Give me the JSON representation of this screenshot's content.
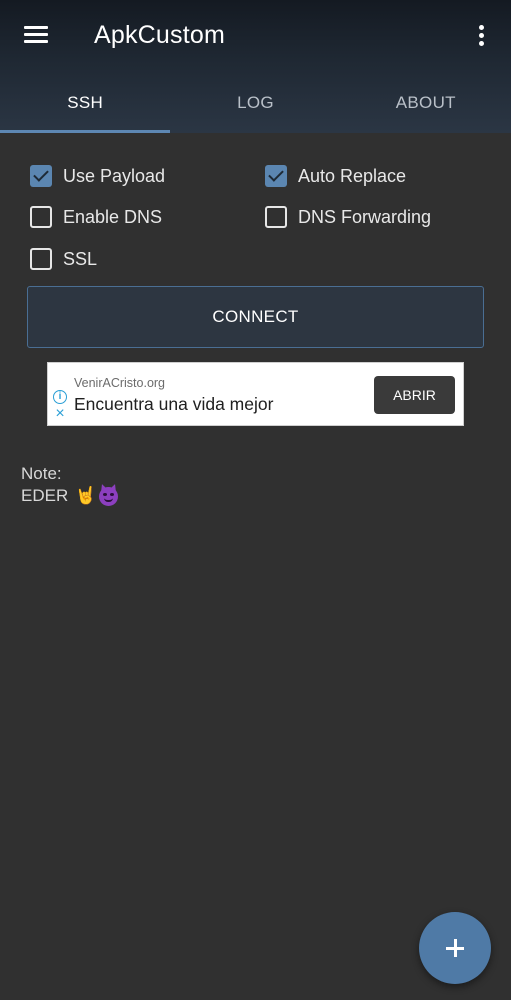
{
  "app": {
    "title": "ApkCustom"
  },
  "tabs": [
    {
      "label": "SSH",
      "active": true
    },
    {
      "label": "LOG",
      "active": false
    },
    {
      "label": "ABOUT",
      "active": false
    }
  ],
  "options": {
    "use_payload": {
      "label": "Use Payload",
      "checked": true
    },
    "auto_replace": {
      "label": "Auto Replace",
      "checked": true
    },
    "enable_dns": {
      "label": "Enable DNS",
      "checked": false
    },
    "dns_forwarding": {
      "label": "DNS Forwarding",
      "checked": false
    },
    "ssl": {
      "label": "SSL",
      "checked": false
    }
  },
  "connect": {
    "label": "CONNECT"
  },
  "ad": {
    "url": "VenirACristo.org",
    "headline": "Encuentra una vida mejor",
    "button": "ABRIR"
  },
  "note": {
    "label": "Note:",
    "text": "EDER",
    "emojis": [
      "sign-of-horns-emoji",
      "smiling-imp-emoji"
    ]
  },
  "icons": {
    "menu": "hamburger-menu-icon",
    "overflow": "more-vert-icon",
    "fab": "plus-icon"
  },
  "colors": {
    "accent": "#5b86b1",
    "background": "#303030",
    "fab": "#4f7aa6"
  }
}
